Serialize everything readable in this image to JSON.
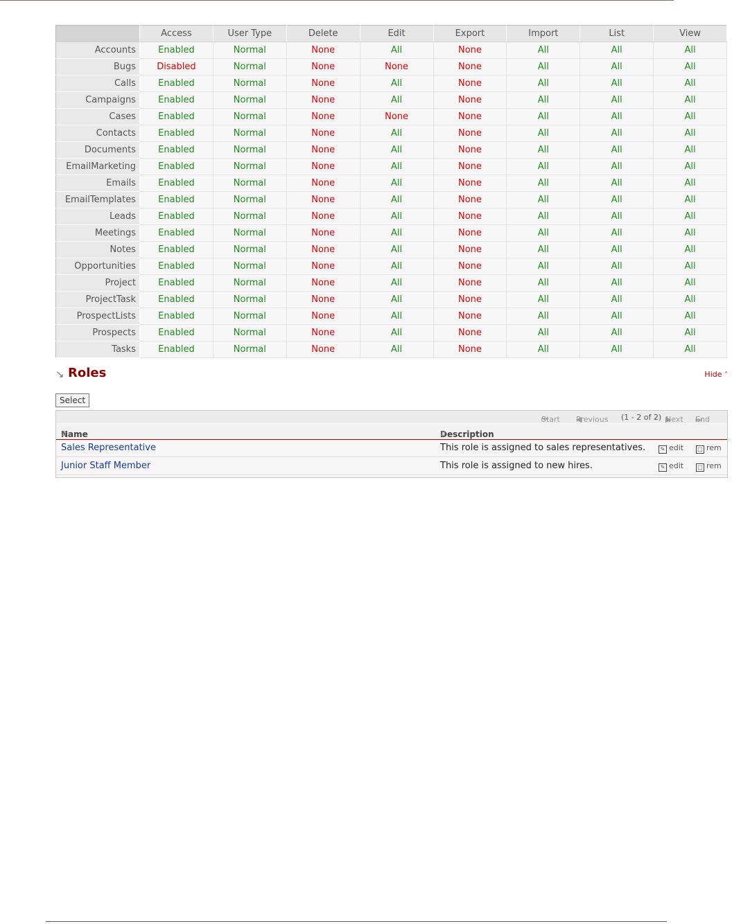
{
  "acl_table": {
    "headers": [
      "Access",
      "User Type",
      "Delete",
      "Edit",
      "Export",
      "Import",
      "List",
      "View"
    ],
    "rows": [
      {
        "module": "Accounts",
        "cells": [
          "Enabled",
          "Normal",
          "None",
          "All",
          "None",
          "All",
          "All",
          "All"
        ]
      },
      {
        "module": "Bugs",
        "cells": [
          "Disabled",
          "Normal",
          "None",
          "None",
          "None",
          "All",
          "All",
          "All"
        ]
      },
      {
        "module": "Calls",
        "cells": [
          "Enabled",
          "Normal",
          "None",
          "All",
          "None",
          "All",
          "All",
          "All"
        ]
      },
      {
        "module": "Campaigns",
        "cells": [
          "Enabled",
          "Normal",
          "None",
          "All",
          "None",
          "All",
          "All",
          "All"
        ]
      },
      {
        "module": "Cases",
        "cells": [
          "Enabled",
          "Normal",
          "None",
          "None",
          "None",
          "All",
          "All",
          "All"
        ]
      },
      {
        "module": "Contacts",
        "cells": [
          "Enabled",
          "Normal",
          "None",
          "All",
          "None",
          "All",
          "All",
          "All"
        ]
      },
      {
        "module": "Documents",
        "cells": [
          "Enabled",
          "Normal",
          "None",
          "All",
          "None",
          "All",
          "All",
          "All"
        ]
      },
      {
        "module": "EmailMarketing",
        "cells": [
          "Enabled",
          "Normal",
          "None",
          "All",
          "None",
          "All",
          "All",
          "All"
        ]
      },
      {
        "module": "Emails",
        "cells": [
          "Enabled",
          "Normal",
          "None",
          "All",
          "None",
          "All",
          "All",
          "All"
        ]
      },
      {
        "module": "EmailTemplates",
        "cells": [
          "Enabled",
          "Normal",
          "None",
          "All",
          "None",
          "All",
          "All",
          "All"
        ]
      },
      {
        "module": "Leads",
        "cells": [
          "Enabled",
          "Normal",
          "None",
          "All",
          "None",
          "All",
          "All",
          "All"
        ]
      },
      {
        "module": "Meetings",
        "cells": [
          "Enabled",
          "Normal",
          "None",
          "All",
          "None",
          "All",
          "All",
          "All"
        ]
      },
      {
        "module": "Notes",
        "cells": [
          "Enabled",
          "Normal",
          "None",
          "All",
          "None",
          "All",
          "All",
          "All"
        ]
      },
      {
        "module": "Opportunities",
        "cells": [
          "Enabled",
          "Normal",
          "None",
          "All",
          "None",
          "All",
          "All",
          "All"
        ]
      },
      {
        "module": "Project",
        "cells": [
          "Enabled",
          "Normal",
          "None",
          "All",
          "None",
          "All",
          "All",
          "All"
        ]
      },
      {
        "module": "ProjectTask",
        "cells": [
          "Enabled",
          "Normal",
          "None",
          "All",
          "None",
          "All",
          "All",
          "All"
        ]
      },
      {
        "module": "ProspectLists",
        "cells": [
          "Enabled",
          "Normal",
          "None",
          "All",
          "None",
          "All",
          "All",
          "All"
        ]
      },
      {
        "module": "Prospects",
        "cells": [
          "Enabled",
          "Normal",
          "None",
          "All",
          "None",
          "All",
          "All",
          "All"
        ]
      },
      {
        "module": "Tasks",
        "cells": [
          "Enabled",
          "Normal",
          "None",
          "All",
          "None",
          "All",
          "All",
          "All"
        ]
      }
    ]
  },
  "colors": {
    "positive": "#1e8c1e",
    "negative": "#e00000"
  },
  "roles": {
    "title": "Roles",
    "hide_label": "Hide",
    "select_label": "Select",
    "pager": {
      "start": "Start",
      "previous": "Previous",
      "range": "(1 - 2 of 2)",
      "next": "Next",
      "end": "End"
    },
    "columns": {
      "name": "Name",
      "description": "Description"
    },
    "rows": [
      {
        "name": "Sales Representative",
        "description": "This role is assigned to sales representatives.",
        "edit": "edit",
        "remove": "rem"
      },
      {
        "name": "Junior Staff Member",
        "description": "This role is assigned to new hires.",
        "edit": "edit",
        "remove": "rem"
      }
    ]
  }
}
